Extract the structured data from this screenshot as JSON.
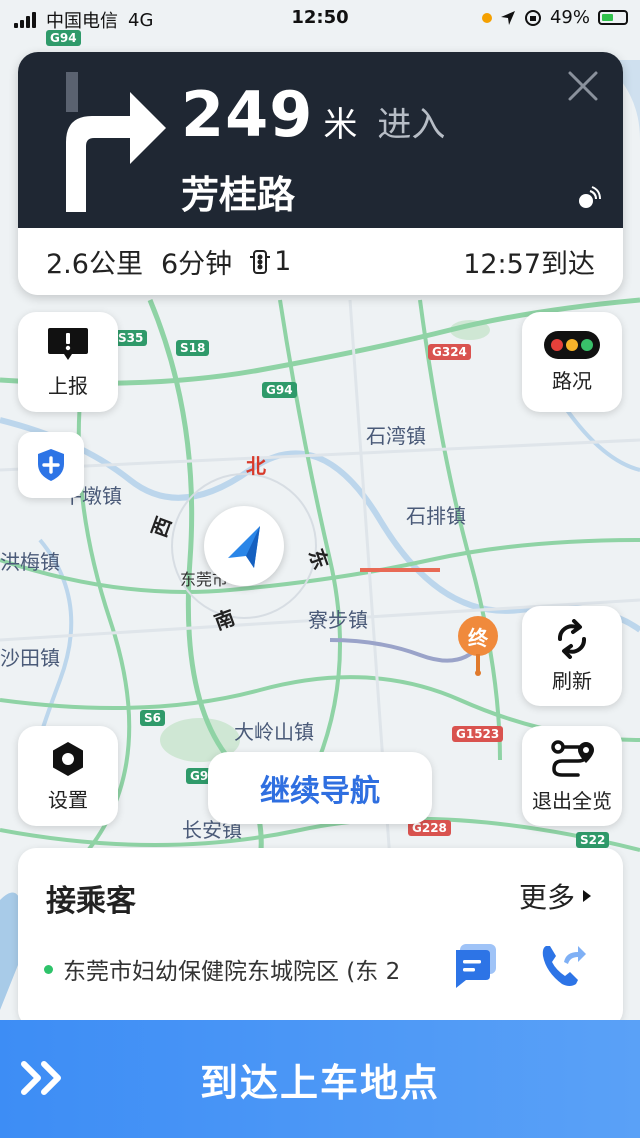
{
  "status_bar": {
    "carrier": "中国电信",
    "network": "4G",
    "time": "12:50",
    "battery": "49%"
  },
  "guidance": {
    "distance": "249",
    "distance_unit": "米",
    "action": "进入",
    "road": "芳桂路",
    "total_distance": "2.6公里",
    "total_time": "6分钟",
    "traffic_lights": "1",
    "eta": "12:57到达"
  },
  "map": {
    "places": [
      "石湾镇",
      "牛墩镇",
      "石排镇",
      "洪梅镇",
      "东莞市",
      "寮步镇",
      "沙田镇",
      "大岭山镇",
      "长安镇"
    ],
    "compass": {
      "north": "北",
      "west": "西",
      "east": "东",
      "south": "南"
    },
    "roads": [
      "G94",
      "S35",
      "S18",
      "G324",
      "G94",
      "S6",
      "G9",
      "G1523",
      "G228",
      "S22"
    ],
    "destination_marker": "终"
  },
  "buttons": {
    "report": "上报",
    "traffic": "路况",
    "refresh": "刷新",
    "settings": "设置",
    "exit_overview": "退出全览",
    "continue_nav": "继续导航"
  },
  "passenger": {
    "title": "接乘客",
    "more": "更多",
    "address": "东莞市妇幼保健院东城院区 (东 2"
  },
  "arrive_button": "到达上车地点",
  "colors": {
    "guide_bg": "#1f2733",
    "accent_blue": "#2f6fe0",
    "arrive_bar": "#4a95f6",
    "destination": "#f08a3c"
  }
}
